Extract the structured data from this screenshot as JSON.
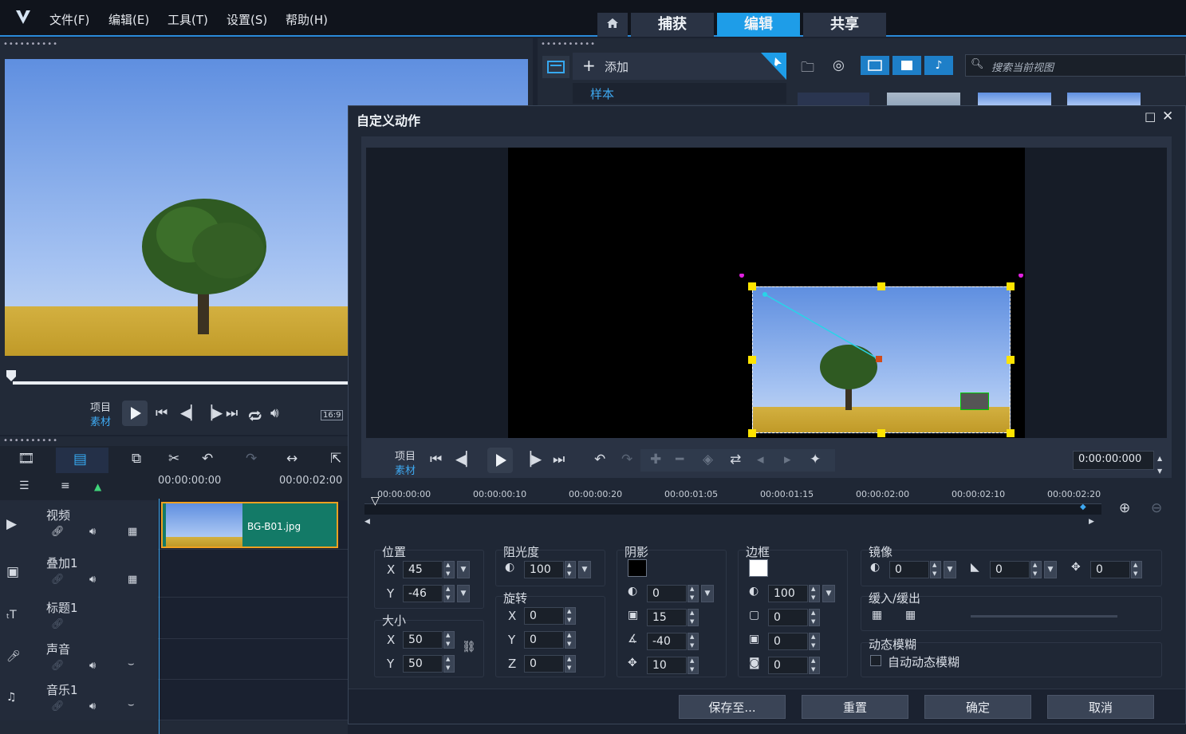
{
  "menu": [
    "文件(F)",
    "编辑(E)",
    "工具(T)",
    "设置(S)",
    "帮助(H)"
  ],
  "nav_tabs": [
    "捕获",
    "编辑",
    "共享"
  ],
  "library": {
    "add_label": "添加",
    "sample_label": "样本",
    "search_placeholder": "搜索当前视图"
  },
  "player": {
    "project_label": "项目",
    "clip_label": "素材",
    "aspect": "16:9"
  },
  "timeline": {
    "time_start": "00:00:00:00",
    "time_mid": "00:00:02:00",
    "tracks": [
      {
        "name": "视频"
      },
      {
        "name": "叠加1"
      },
      {
        "name": "标题1"
      },
      {
        "name": "声音"
      },
      {
        "name": "音乐1"
      }
    ],
    "clip_name": "BG-B01.jpg"
  },
  "dialog": {
    "title": "自定义动作",
    "project_label": "项目",
    "clip_label": "素材",
    "timecode": "0:00:00:000",
    "ruler": [
      "00:00:00:00",
      "00:00:00:10",
      "00:00:00:20",
      "00:00:01:05",
      "00:00:01:15",
      "00:00:02:00",
      "00:00:02:10",
      "00:00:02:20"
    ],
    "position": {
      "label": "位置",
      "x_label": "X",
      "x": "45",
      "y_label": "Y",
      "y": "-46"
    },
    "size": {
      "label": "大小",
      "x_label": "X",
      "x": "50",
      "y_label": "Y",
      "y": "50"
    },
    "opacity": {
      "label": "阻光度",
      "value": "100"
    },
    "rotation": {
      "label": "旋转",
      "x_label": "X",
      "x": "0",
      "y_label": "Y",
      "y": "0",
      "z_label": "Z",
      "z": "0"
    },
    "shadow": {
      "label": "阴影",
      "opacity": "0",
      "blur": "15",
      "angle": "-40",
      "distance": "10"
    },
    "border": {
      "label": "边框",
      "opacity": "100",
      "width": "0",
      "v2": "0",
      "v3": "0"
    },
    "mirror": {
      "label": "镜像",
      "v1": "0",
      "v2": "0",
      "v3": "0"
    },
    "ease": {
      "label": "缓入/缓出"
    },
    "motion_blur": {
      "label": "动态模糊",
      "checkbox_label": "自动动态模糊"
    },
    "buttons": {
      "save": "保存至...",
      "reset": "重置",
      "ok": "确定",
      "cancel": "取消"
    }
  },
  "colors": {
    "accent": "#1e9de8",
    "bg": "#1b2230",
    "clip": "#137a67"
  }
}
